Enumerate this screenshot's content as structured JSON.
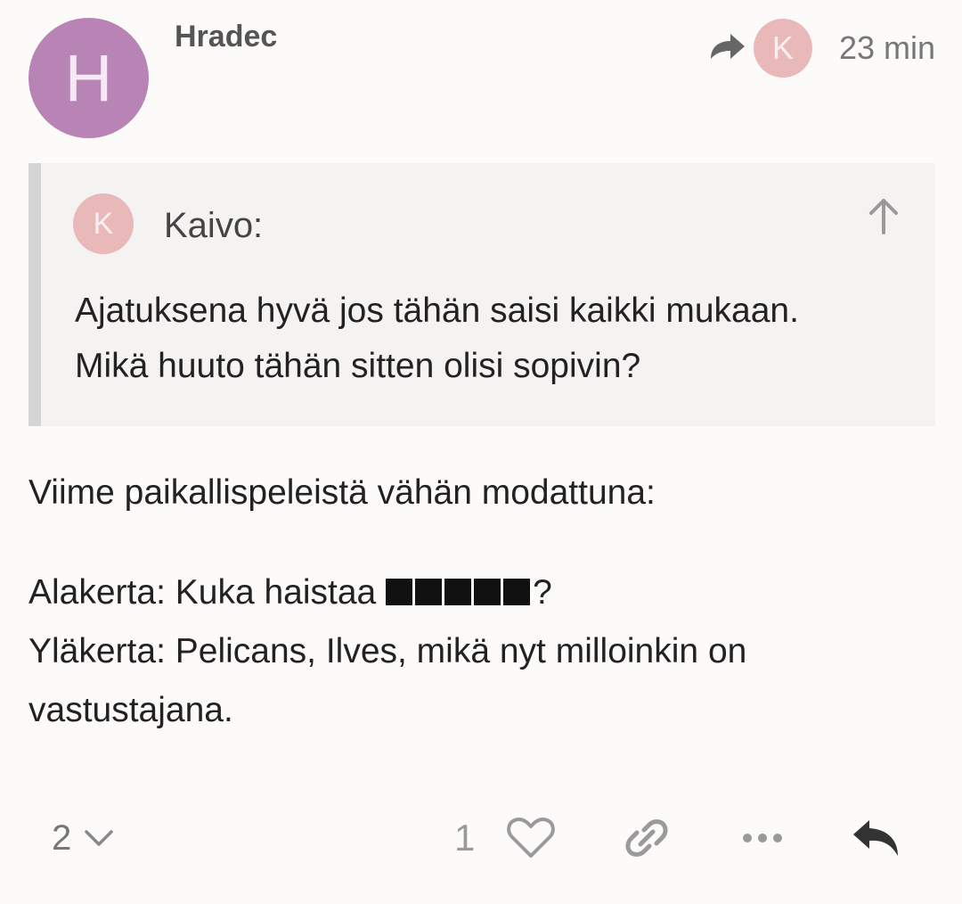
{
  "post": {
    "author_initial": "H",
    "author_name": "Hradec",
    "reply_to_initial": "K",
    "timestamp": "23 min",
    "avatar_color": "#b784b5",
    "reply_avatar_color": "#e9b9ba"
  },
  "quote": {
    "author_initial": "K",
    "author_name": "Kaivo:",
    "lines": [
      "Ajatuksena hyvä jos tähän saisi kaikki mukaan.",
      "Mikä huuto tähän sitten olisi sopivin?"
    ]
  },
  "body": {
    "intro": "Viime paikallispeleistä vähän modattuna:",
    "line1_prefix": "Alakerta: Kuka haistaa ",
    "line1_redacted_blocks": 5,
    "line1_suffix": "?",
    "line2": "Yläkerta: Pelicans, Ilves, mikä nyt milloinkin on",
    "line3": "vastustajana."
  },
  "actions": {
    "reply_count": "2",
    "like_count": "1",
    "icons": [
      "chevron-down-icon",
      "heart-icon",
      "link-icon",
      "more-icon",
      "reply-icon"
    ]
  }
}
